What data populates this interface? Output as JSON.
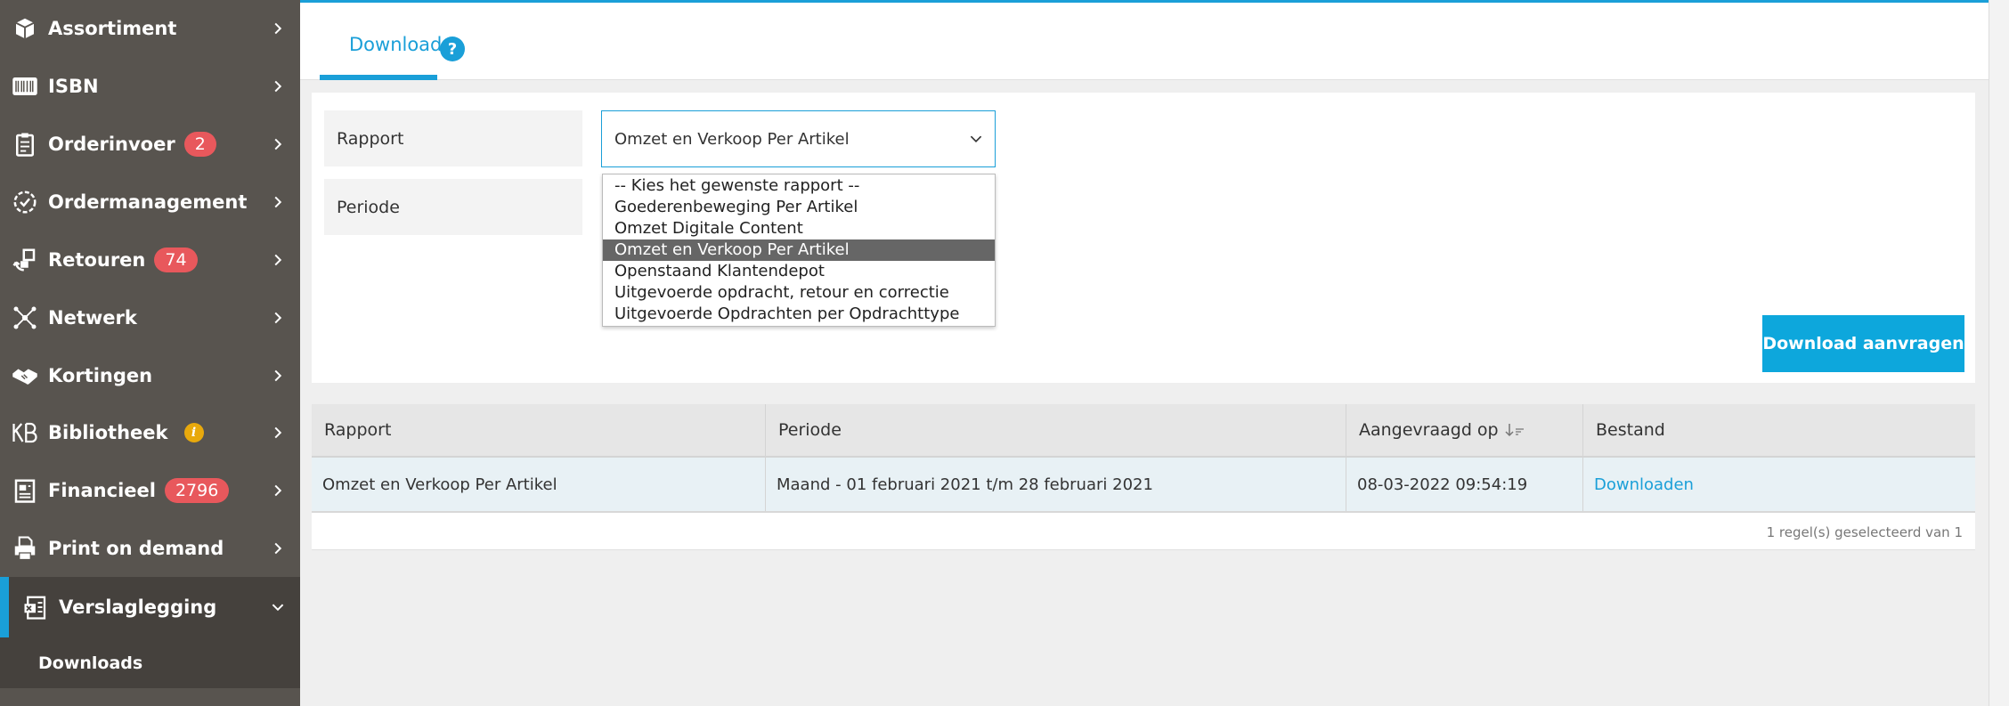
{
  "sidebar": {
    "items": [
      {
        "label": "Assortiment",
        "icon": "box-icon"
      },
      {
        "label": "ISBN",
        "icon": "barcode-icon"
      },
      {
        "label": "Orderinvoer",
        "icon": "clipboard-icon",
        "badge": "2"
      },
      {
        "label": "Ordermanagement",
        "icon": "check-circle-icon"
      },
      {
        "label": "Retouren",
        "icon": "returns-icon",
        "badge": "74"
      },
      {
        "label": "Netwerk",
        "icon": "network-icon"
      },
      {
        "label": "Kortingen",
        "icon": "handshake-icon"
      },
      {
        "label": "Bibliotheek",
        "icon": "kb-logo-icon",
        "info": "i"
      },
      {
        "label": "Financieel",
        "icon": "invoice-icon",
        "badge": "2796"
      },
      {
        "label": "Print on demand",
        "icon": "printer-icon"
      },
      {
        "label": "Verslaglegging",
        "icon": "report-icon",
        "active": true
      }
    ],
    "sub_items": [
      {
        "label": "Downloads"
      }
    ]
  },
  "tabs": [
    {
      "label": "Downloads",
      "help": "?"
    }
  ],
  "form": {
    "rapport_label": "Rapport",
    "periode_label": "Periode",
    "selected_report": "Omzet en Verkoop Per Artikel",
    "options": [
      "-- Kies het gewenste rapport --",
      "Goederenbeweging Per Artikel",
      "Omzet Digitale Content",
      "Omzet en Verkoop Per Artikel",
      "Openstaand Klantendepot",
      "Uitgevoerde opdracht, retour en correctie",
      "Uitgevoerde Opdrachten per Opdrachttype"
    ],
    "selected_index": 3,
    "download_button": "Download aanvragen"
  },
  "table": {
    "columns": [
      "Rapport",
      "Periode",
      "Aangevraagd op",
      "Bestand"
    ],
    "rows": [
      [
        "Omzet en Verkoop Per Artikel",
        "Maand - 01 februari 2021 t/m 28 februari 2021",
        "08-03-2022 09:54:19",
        "Downloaden"
      ]
    ],
    "footer": "1 regel(s) geselecteerd van   1"
  },
  "colors": {
    "accent": "#1a9fd8",
    "sidebar": "#58544f",
    "badge": "#e8585c",
    "button": "#0da7dc"
  }
}
